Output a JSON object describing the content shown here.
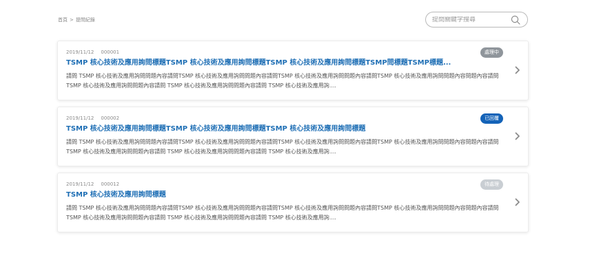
{
  "breadcrumb": {
    "home": "首頁",
    "separator": ">",
    "current": "提問紀錄"
  },
  "search": {
    "placeholder": "提問關鍵字搜尋",
    "value": ""
  },
  "colors": {
    "title": "#1f6fb5",
    "processing": "#8f959b",
    "replied": "#1463b8",
    "pending": "#c9ced3"
  },
  "items": [
    {
      "date": "2019/11/12",
      "id": "000001",
      "status": "處理中",
      "status_color": "#8f959b",
      "title": "TSMP 核心技術及應用詢問標題TSMP 核心技術及應用詢問標題TSMP 核心技術及應用詢問標題TSMP問標題TSMP標題...",
      "excerpt": "請問 TSMP 核心技術及應用詢問問題內容請問TSMP 核心技術及應用詢問問題內容請問TSMP 核心技術及應用詢問問題內容請問TSMP 核心技術及應用詢問問題內容問題內容請問 TSMP 核心技術及應用詢問問題內容請問 TSMP 核心技術及應用詢問問題內容請問 TSMP 核心技術及應用詢...."
    },
    {
      "date": "2019/11/12",
      "id": "000002",
      "status": "已回覆",
      "status_color": "#1463b8",
      "title": "TSMP 核心技術及應用詢問標題TSMP 核心技術及應用詢問標題TSMP 核心技術及應用詢問標題",
      "excerpt": "請問 TSMP 核心技術及應用詢問問題內容請問TSMP 核心技術及應用詢問問題內容請問TSMP 核心技術及應用詢問問題內容請問TSMP 核心技術及應用詢問問題內容問題內容請問 TSMP 核心技術及應用詢問問題內容請問 TSMP 核心技術及應用詢問問題內容請問 TSMP 核心技術及應用詢...."
    },
    {
      "date": "2019/11/12",
      "id": "000012",
      "status": "待處理",
      "status_color": "#c9ced3",
      "title": "TSMP 核心技術及應用詢問標題",
      "excerpt": "請問 TSMP 核心技術及應用詢問問題內容請問TSMP 核心技術及應用詢問問題內容請問TSMP 核心技術及應用詢問問題內容請問TSMP 核心技術及應用詢問問題內容問題內容請問 TSMP 核心技術及應用詢問問題內容請問 TSMP 核心技術及應用詢問問題內容請問 TSMP 核心技術及應用詢...."
    }
  ]
}
